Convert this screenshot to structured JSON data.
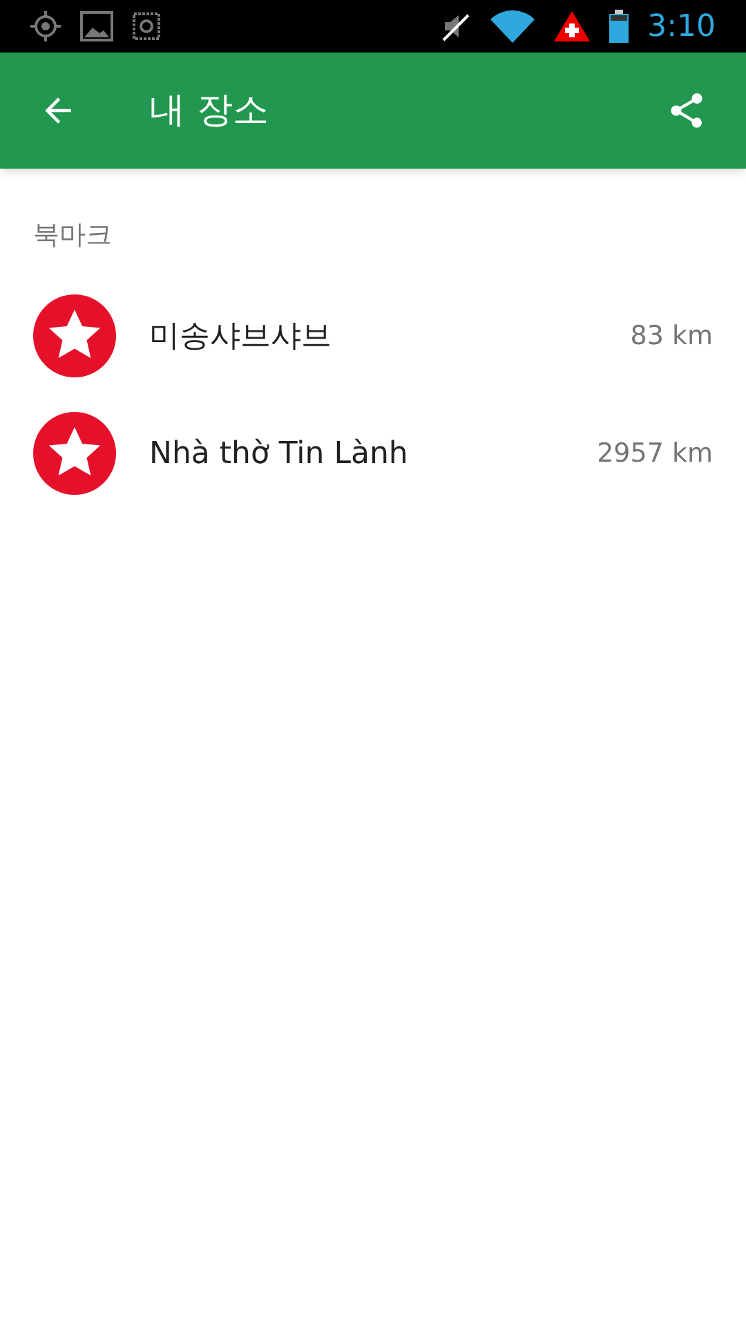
{
  "status_bar": {
    "time": "3:10"
  },
  "app_bar": {
    "title": "내 장소"
  },
  "section": {
    "title": "북마크"
  },
  "bookmarks": [
    {
      "name": "미송샤브샤브",
      "distance": "83 km"
    },
    {
      "name": "Nhà thờ Tin Lành",
      "distance": "2957 km"
    }
  ]
}
